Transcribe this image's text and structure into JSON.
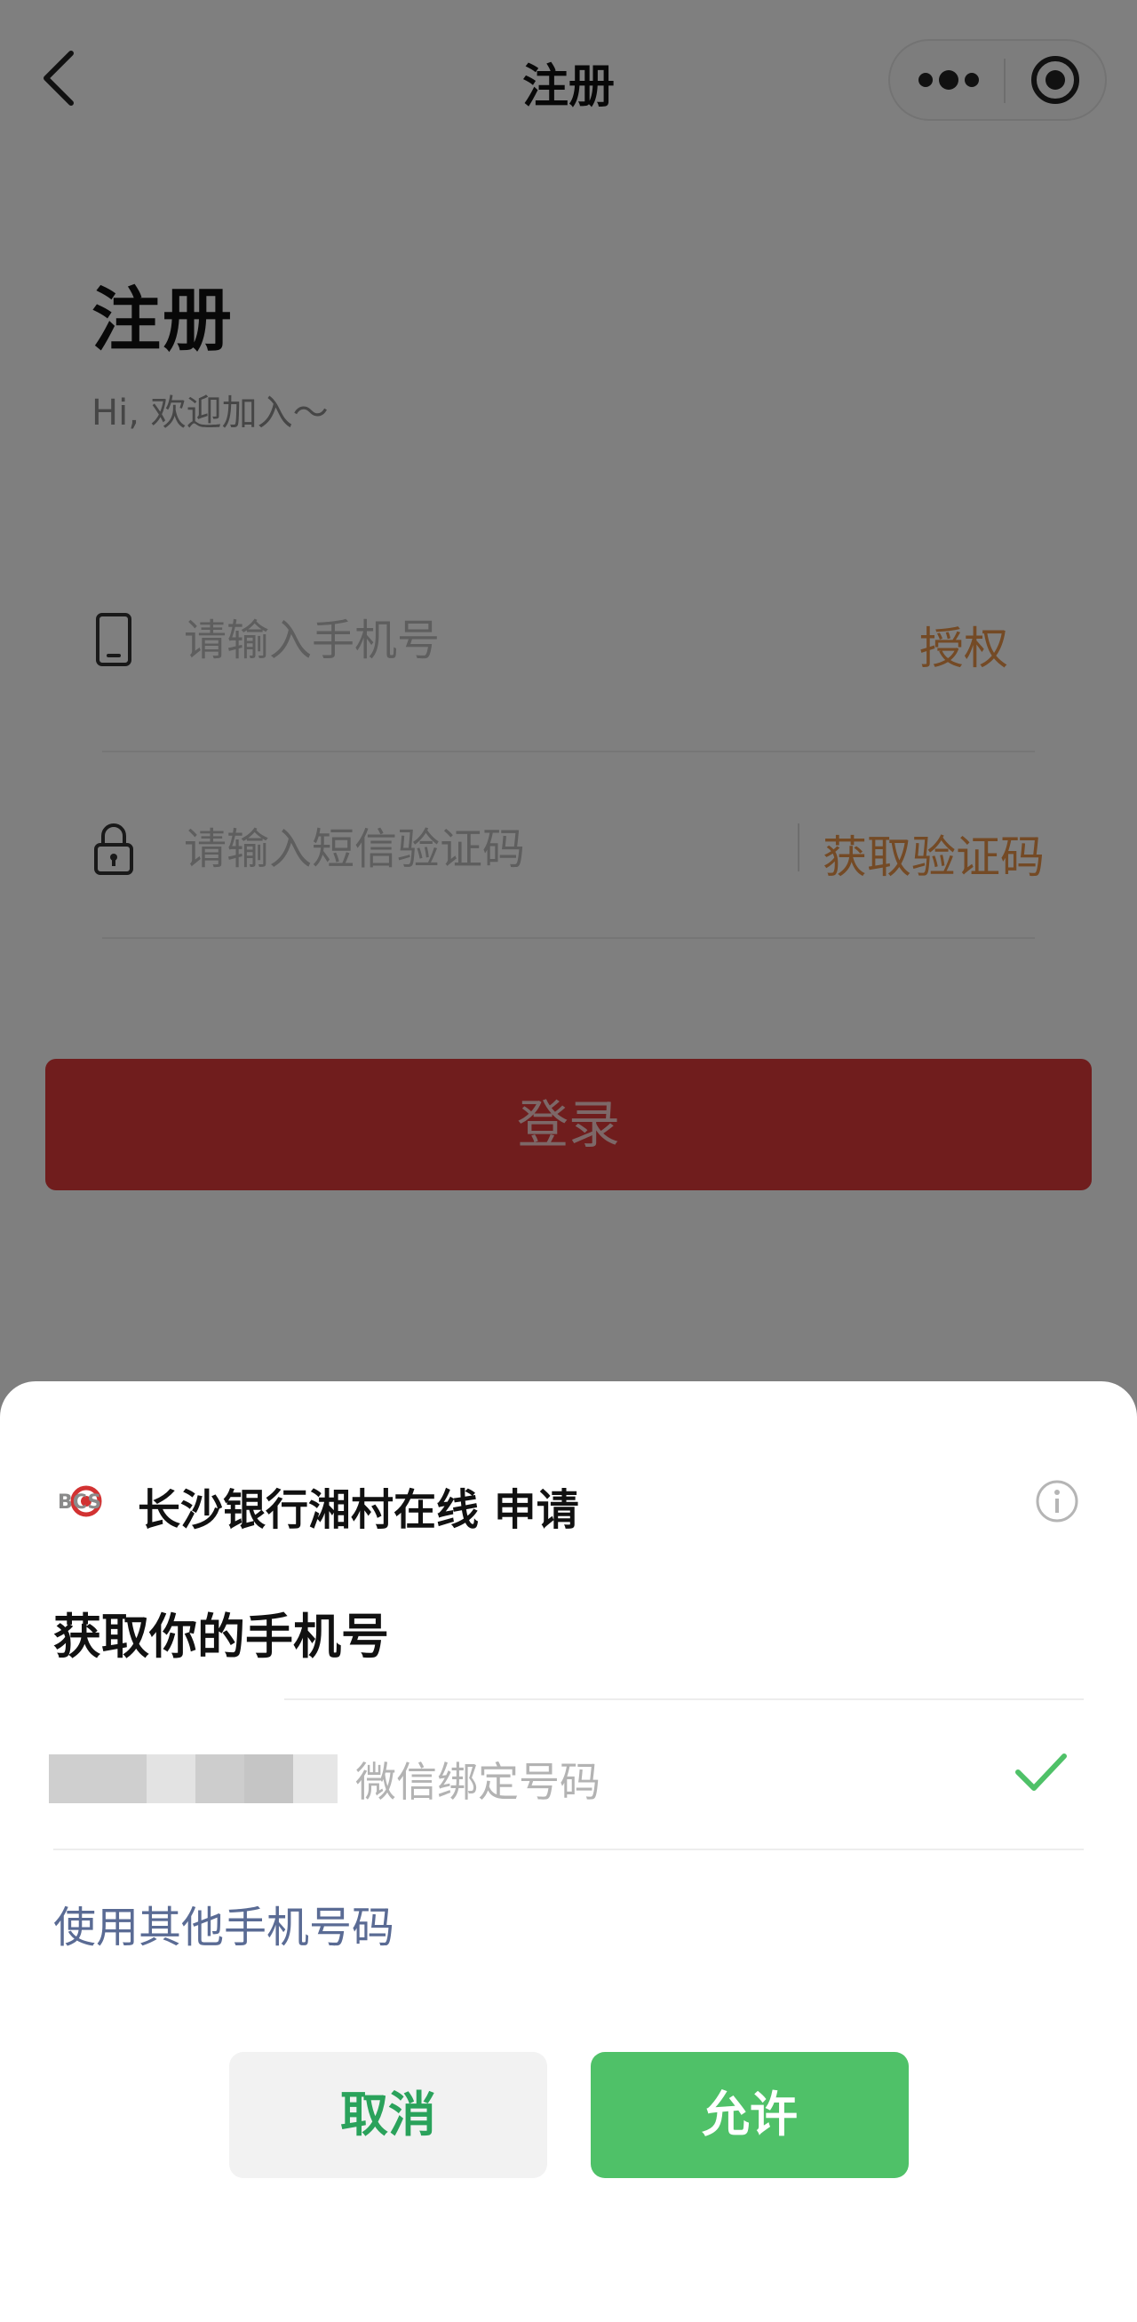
{
  "nav": {
    "title": "注册"
  },
  "header": {
    "title": "注册",
    "subtitle": "Hi, 欢迎加入～"
  },
  "form": {
    "phone_placeholder": "请输入手机号",
    "authorize_label": "授权",
    "sms_placeholder": "请输入短信验证码",
    "get_code_label": "获取验证码",
    "login_label": "登录"
  },
  "sheet": {
    "logo_text": "BCS",
    "app_name": "长沙银行湘村在线 申请",
    "title": "获取你的手机号",
    "phone_option_label": "微信绑定号码",
    "other_phone_label": "使用其他手机号码",
    "cancel_label": "取消",
    "allow_label": "允许"
  },
  "icons": {
    "back": "chevron-left-icon",
    "more": "more-dots-icon",
    "close": "target-circle-icon",
    "phone": "phone-icon",
    "lock": "lock-icon",
    "info": "info-icon",
    "check": "check-icon"
  },
  "colors": {
    "accent_orange": "#e8944a",
    "login_red": "#e03b3b",
    "wechat_green": "#4fc168",
    "link_blue": "#5a6b94"
  }
}
